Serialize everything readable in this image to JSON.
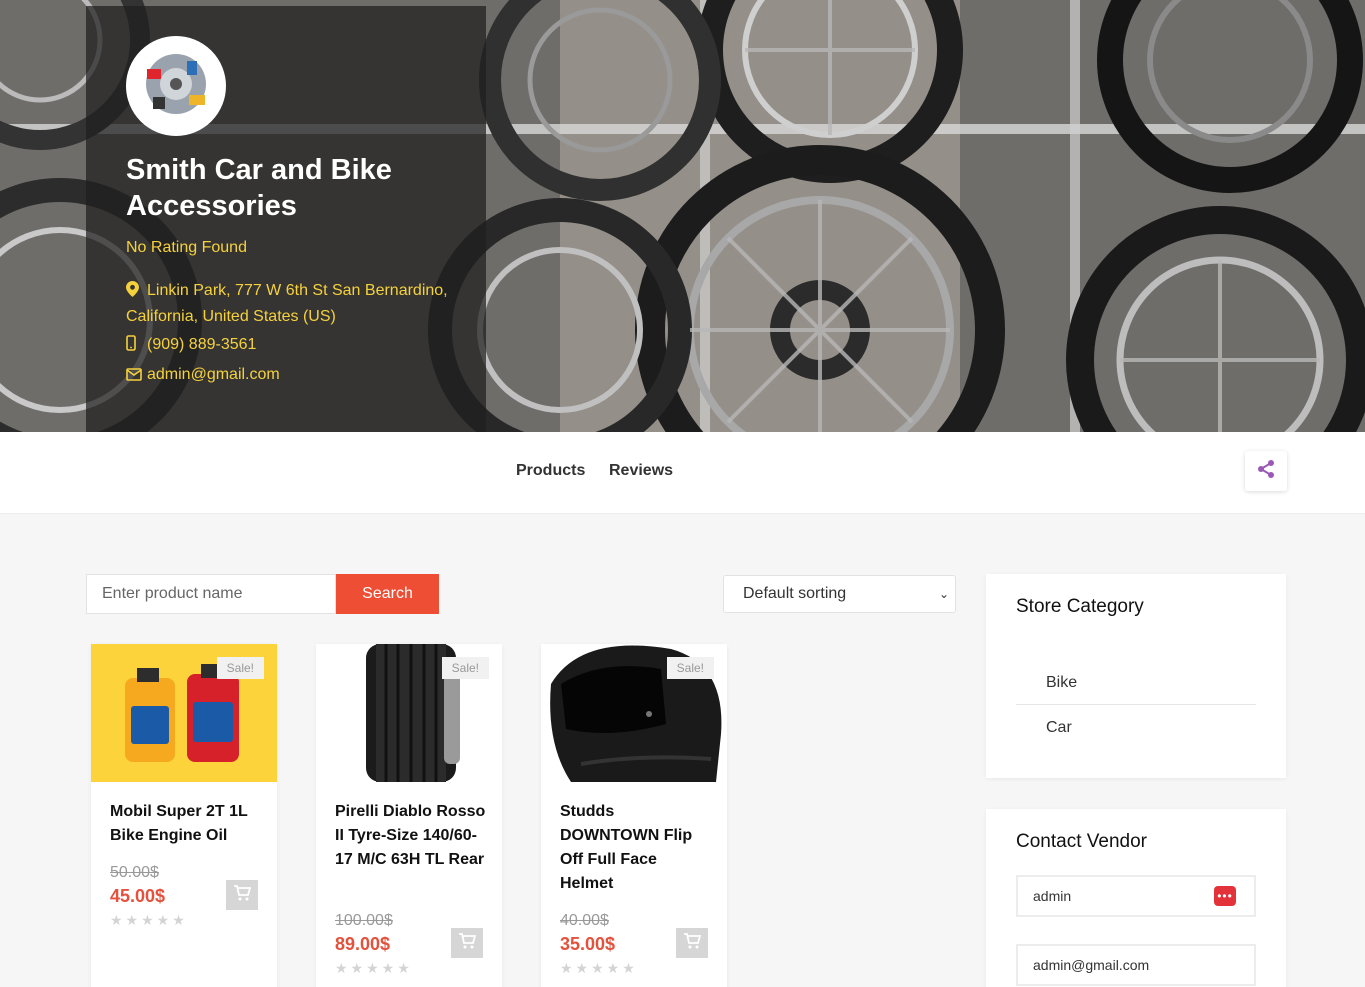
{
  "store": {
    "name": "Smith Car and Bike Accessories",
    "rating": "No Rating Found",
    "address": "Linkin Park, 777 W 6th St San Bernardino, California, United States (US)",
    "phone": "(909) 889-3561",
    "email": "admin@gmail.com"
  },
  "tabs": [
    {
      "label": "Products"
    },
    {
      "label": "Reviews"
    }
  ],
  "search": {
    "placeholder": "Enter product name",
    "button": "Search"
  },
  "sort": {
    "selected": "Default sorting"
  },
  "products": [
    {
      "title": "Mobil Super 2T 1L Bike Engine Oil",
      "badge": "Sale!",
      "old_price": "50.00$",
      "new_price": "45.00$",
      "rating": 0
    },
    {
      "title": "Pirelli Diablo Rosso II Tyre-Size 140/60-17 M/C 63H TL Rear",
      "badge": "Sale!",
      "old_price": "100.00$",
      "new_price": "89.00$",
      "rating": 0
    },
    {
      "title": "Studds DOWNTOWN Flip Off Full Face Helmet",
      "badge": "Sale!",
      "old_price": "40.00$",
      "new_price": "35.00$",
      "rating": 0
    }
  ],
  "sidebar": {
    "category_title": "Store Category",
    "categories": [
      {
        "label": "Bike"
      },
      {
        "label": "Car"
      }
    ],
    "contact_title": "Contact Vendor",
    "contact_fields": [
      {
        "value": "admin"
      },
      {
        "value": "admin@gmail.com"
      }
    ]
  },
  "colors": {
    "accent": "#ee4e34",
    "price": "#e4513c",
    "rating_text": "#f5d23c",
    "share_icon": "#9b59b6"
  },
  "icons": {
    "address": "map-marker-icon",
    "phone": "mobile-phone-icon",
    "email": "envelope-icon",
    "share": "share-icon",
    "cart": "cart-icon"
  }
}
